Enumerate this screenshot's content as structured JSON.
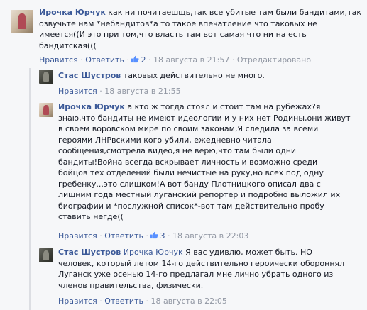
{
  "comments": [
    {
      "author": "Ирочка Юрчук",
      "lines": [
        "как ни почитаешщь,так все убитые там были бандитами,так",
        "озвучьте нам *небандитов*а то такое впечатление что таковых не",
        "имеется((И это при том,что власть там вот самая что ни на есть",
        "бандитская((("
      ],
      "reply_label": "Нравится",
      "answer_label": "Ответить",
      "likes": "2",
      "time": "18 августа в 21:57",
      "edited": "Отредактировано"
    },
    {
      "author": "Стас Шустров",
      "lines": [
        "таковых действительно не много."
      ],
      "reply_label": "Нравится",
      "time": "18 августа в 21:55"
    },
    {
      "author": "Ирочка Юрчук",
      "lines": [
        "а кто ж тогда стоял и стоит там на рубежах?я",
        "знаю,что бандиты не имеют идеологии и у них нет Родины,они живут",
        "в своем воровском мире по своим законам,Я следила за всеми",
        "героями ЛНРвскими кого убили, ежедневно читала",
        "сообщения,смотрела видео,я не верю,что там были одни",
        "бандиты!Война всегда вскрывает личность и возможно среди",
        "бойцов тех отделений были нечистые на руку,но всех под одну",
        "гребенку...это слишком!А вот банду Плотницкого описал два с",
        "лишним года местный луганский репортер и подробно выложил их",
        "биографии и *послужной список*-вот там действительно пробу",
        "ставить негде(("
      ],
      "reply_label": "Нравится",
      "answer_label": "Ответить",
      "likes": "3",
      "time": "18 августа в 22:03"
    },
    {
      "author": "Стас Шустров",
      "mention": "Ирочка Юрчук",
      "first_line_rest": "Я вас удивлю, может быть. НО",
      "lines": [
        "человек, который летом 14-го действительно героически обороннял",
        "Луганск уже осенью 14-го предлагал мне лично убрать одного из",
        "членов правительства, физически."
      ],
      "reply_label": "Нравится",
      "answer_label": "Ответить",
      "time": "18 августа в 22:05"
    }
  ],
  "colors": {
    "link": "#3b5998",
    "meta": "#9197a3",
    "background": "#f6f7f9"
  },
  "icons": {
    "like": "thumbs-up-icon"
  }
}
